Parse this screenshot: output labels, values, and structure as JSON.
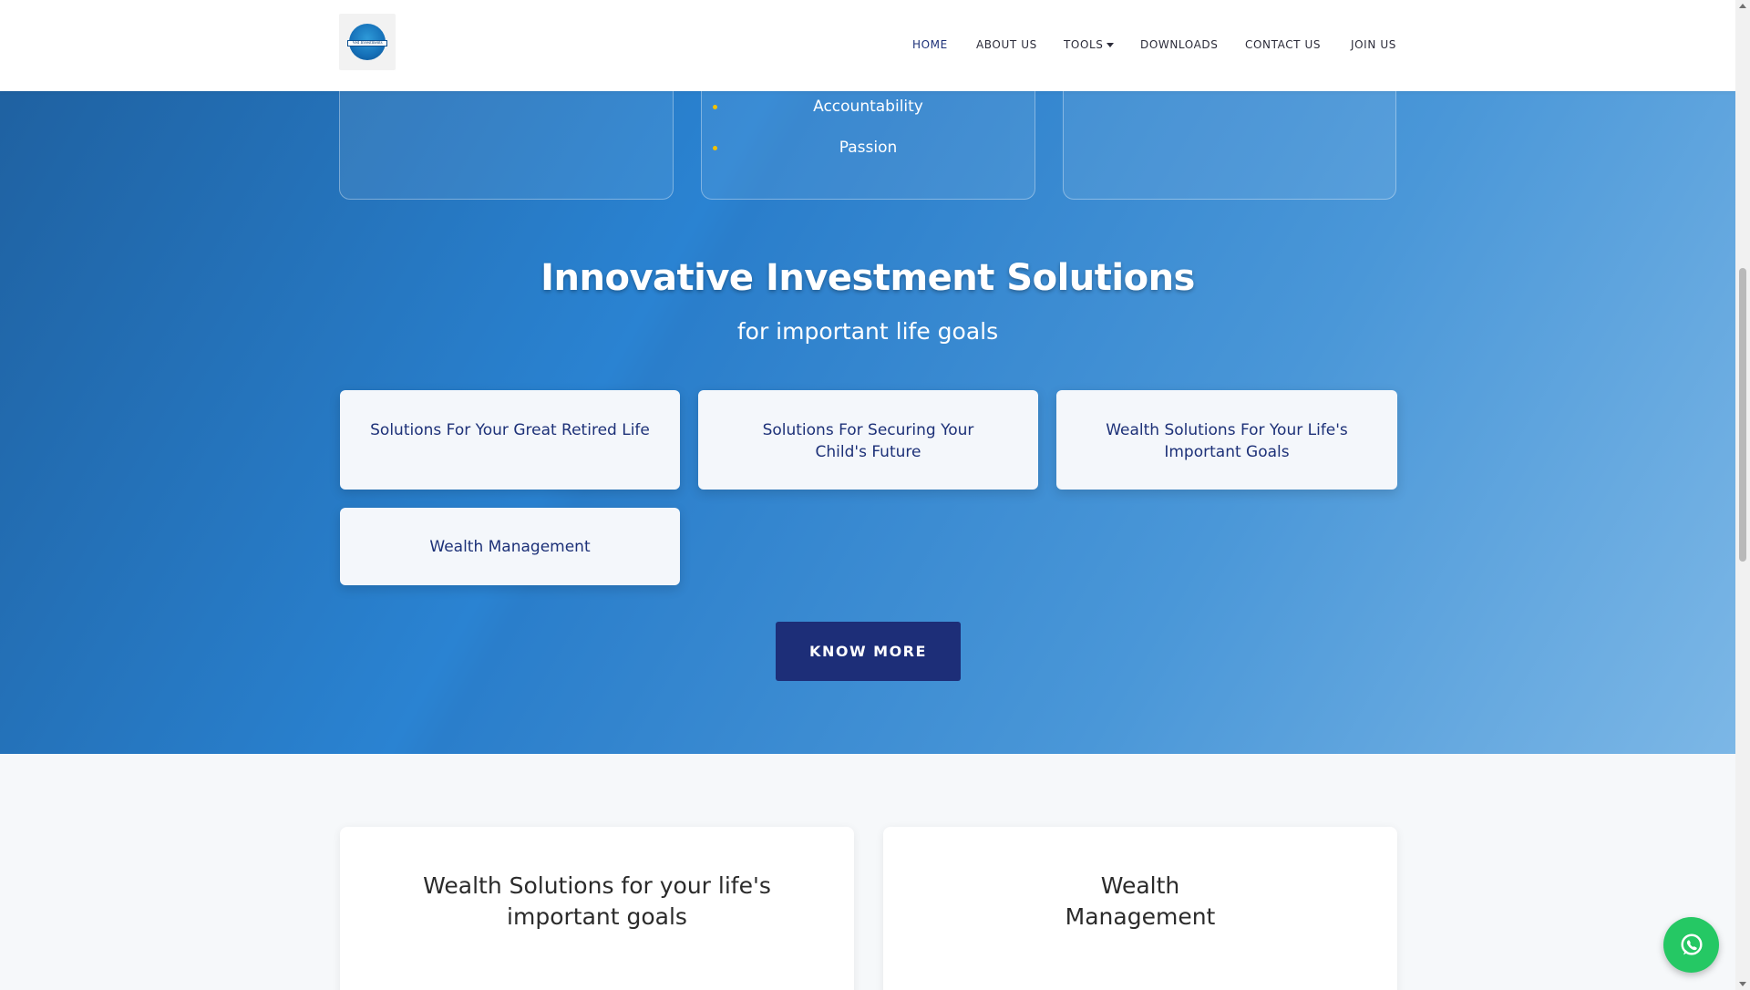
{
  "header": {
    "logo_text": "Ved Investments",
    "nav": [
      {
        "label": "HOME",
        "active": true
      },
      {
        "label": "ABOUT US"
      },
      {
        "label": "TOOLS"
      },
      {
        "label": "DOWNLOADS"
      },
      {
        "label": "CONTACT US"
      },
      {
        "label": "JOIN US"
      }
    ]
  },
  "values_card": {
    "items": [
      "Accountability",
      "Passion"
    ]
  },
  "hero": {
    "title": "Innovative Investment Solutions",
    "subtitle": "for important life goals",
    "solutions": [
      "Solutions For Your Great Retired Life",
      "Solutions For Securing Your Child's Future",
      "Wealth Solutions For Your Life's Important Goals",
      "Wealth Management"
    ],
    "cta_label": "KNOW MORE"
  },
  "lower_cards": [
    "Wealth Solutions for your life's important goals",
    "Wealth Management"
  ],
  "colors": {
    "accent": "#1d2e78",
    "nav_active": "#1d3178",
    "bullet": "#f2c100",
    "whatsapp": "#25c864"
  },
  "icons": {
    "whatsapp": "whatsapp-icon",
    "dropdown": "chevron-down-icon"
  }
}
